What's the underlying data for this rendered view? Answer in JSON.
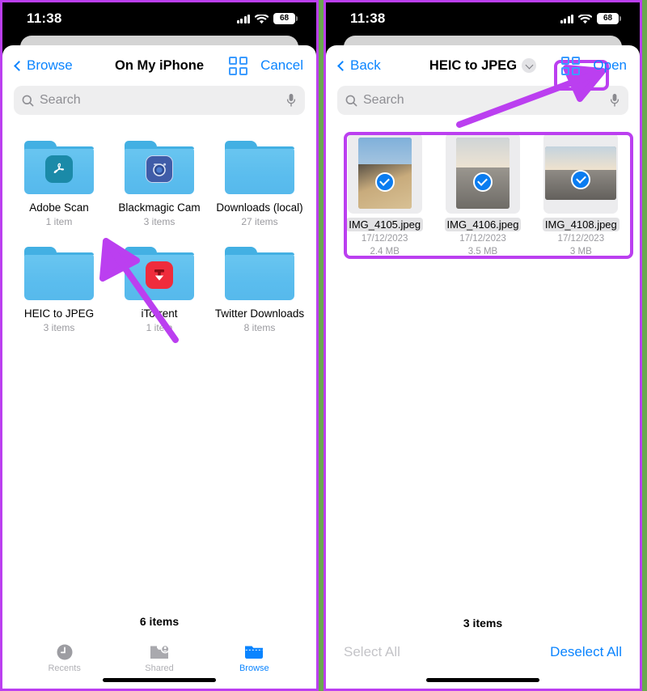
{
  "colors": {
    "accent_blue": "#0a84ff",
    "annotation_purple": "#bb3ff0",
    "divider_green": "#6aa84f",
    "folder_blue": "#5bbdee",
    "muted_gray": "#9a9a9f"
  },
  "status_bar": {
    "time": "11:38",
    "battery_level": "68",
    "signal_icon": "cellular-signal-icon",
    "wifi_icon": "wifi-icon",
    "battery_icon": "battery-icon"
  },
  "left_panel": {
    "nav": {
      "back_label": "Browse",
      "back_icon": "chevron-left-icon",
      "title": "On My iPhone",
      "grid_icon": "grid-view-icon",
      "action_label": "Cancel"
    },
    "search": {
      "placeholder": "Search",
      "search_icon": "search-icon",
      "mic_icon": "microphone-icon"
    },
    "folders": [
      {
        "name": "Adobe Scan",
        "count": "1 item",
        "icon": "folder-icon",
        "badge": "adobe-acrobat-icon",
        "glyph": "A"
      },
      {
        "name": "Blackmagic Cam",
        "count": "3 items",
        "icon": "folder-icon",
        "badge": "blackmagic-camera-icon",
        "glyph": "◎"
      },
      {
        "name": "Downloads (local)",
        "count": "27 items",
        "icon": "folder-icon",
        "badge": "",
        "glyph": ""
      },
      {
        "name": "HEIC to JPEG",
        "count": "3 items",
        "icon": "folder-icon",
        "badge": "",
        "glyph": ""
      },
      {
        "name": "iTorrent",
        "count": "1 item",
        "icon": "folder-icon",
        "badge": "itorrent-icon",
        "glyph": "⤓"
      },
      {
        "name": "Twitter Downloads",
        "count": "8 items",
        "icon": "folder-icon",
        "badge": "",
        "glyph": ""
      }
    ],
    "item_count": "6 items",
    "tabs": [
      {
        "label": "Recents",
        "icon": "clock-icon",
        "active": false
      },
      {
        "label": "Shared",
        "icon": "shared-folder-icon",
        "active": false
      },
      {
        "label": "Browse",
        "icon": "folder-icon",
        "active": true
      }
    ]
  },
  "right_panel": {
    "nav": {
      "back_label": "Back",
      "back_icon": "chevron-left-icon",
      "title": "HEIC to JPEG",
      "title_chevron_icon": "chevron-down-icon",
      "grid_icon": "grid-view-icon",
      "action_label": "Open"
    },
    "search": {
      "placeholder": "Search",
      "search_icon": "search-icon",
      "mic_icon": "microphone-icon"
    },
    "files": [
      {
        "name": "IMG_4105.jpeg",
        "date": "17/12/2023",
        "size": "2.4 MB",
        "selected": true,
        "orientation": "portrait",
        "sky": "#8fb9dd",
        "ground": "#c3a87e",
        "check_icon": "check-circle-icon"
      },
      {
        "name": "IMG_4106.jpeg",
        "date": "17/12/2023",
        "size": "3.5 MB",
        "selected": true,
        "orientation": "portrait",
        "sky": "#dfdcd3",
        "ground": "#8d8b86",
        "check_icon": "check-circle-icon"
      },
      {
        "name": "IMG_4108.jpeg",
        "date": "17/12/2023",
        "size": "3 MB",
        "selected": true,
        "orientation": "landscape",
        "sky": "#cfd9e0",
        "ground": "#8a8782",
        "check_icon": "check-circle-icon"
      }
    ],
    "item_count": "3 items",
    "select_all_label": "Select All",
    "deselect_all_label": "Deselect All"
  },
  "annotations": {
    "left_arrow": "arrow-pointing-to-heic-to-jpeg-folder",
    "right_arrow": "arrow-pointing-to-open-button",
    "right_highlight": "highlight-box-around-selected-files",
    "right_open_highlight": "highlight-box-around-open-button"
  }
}
